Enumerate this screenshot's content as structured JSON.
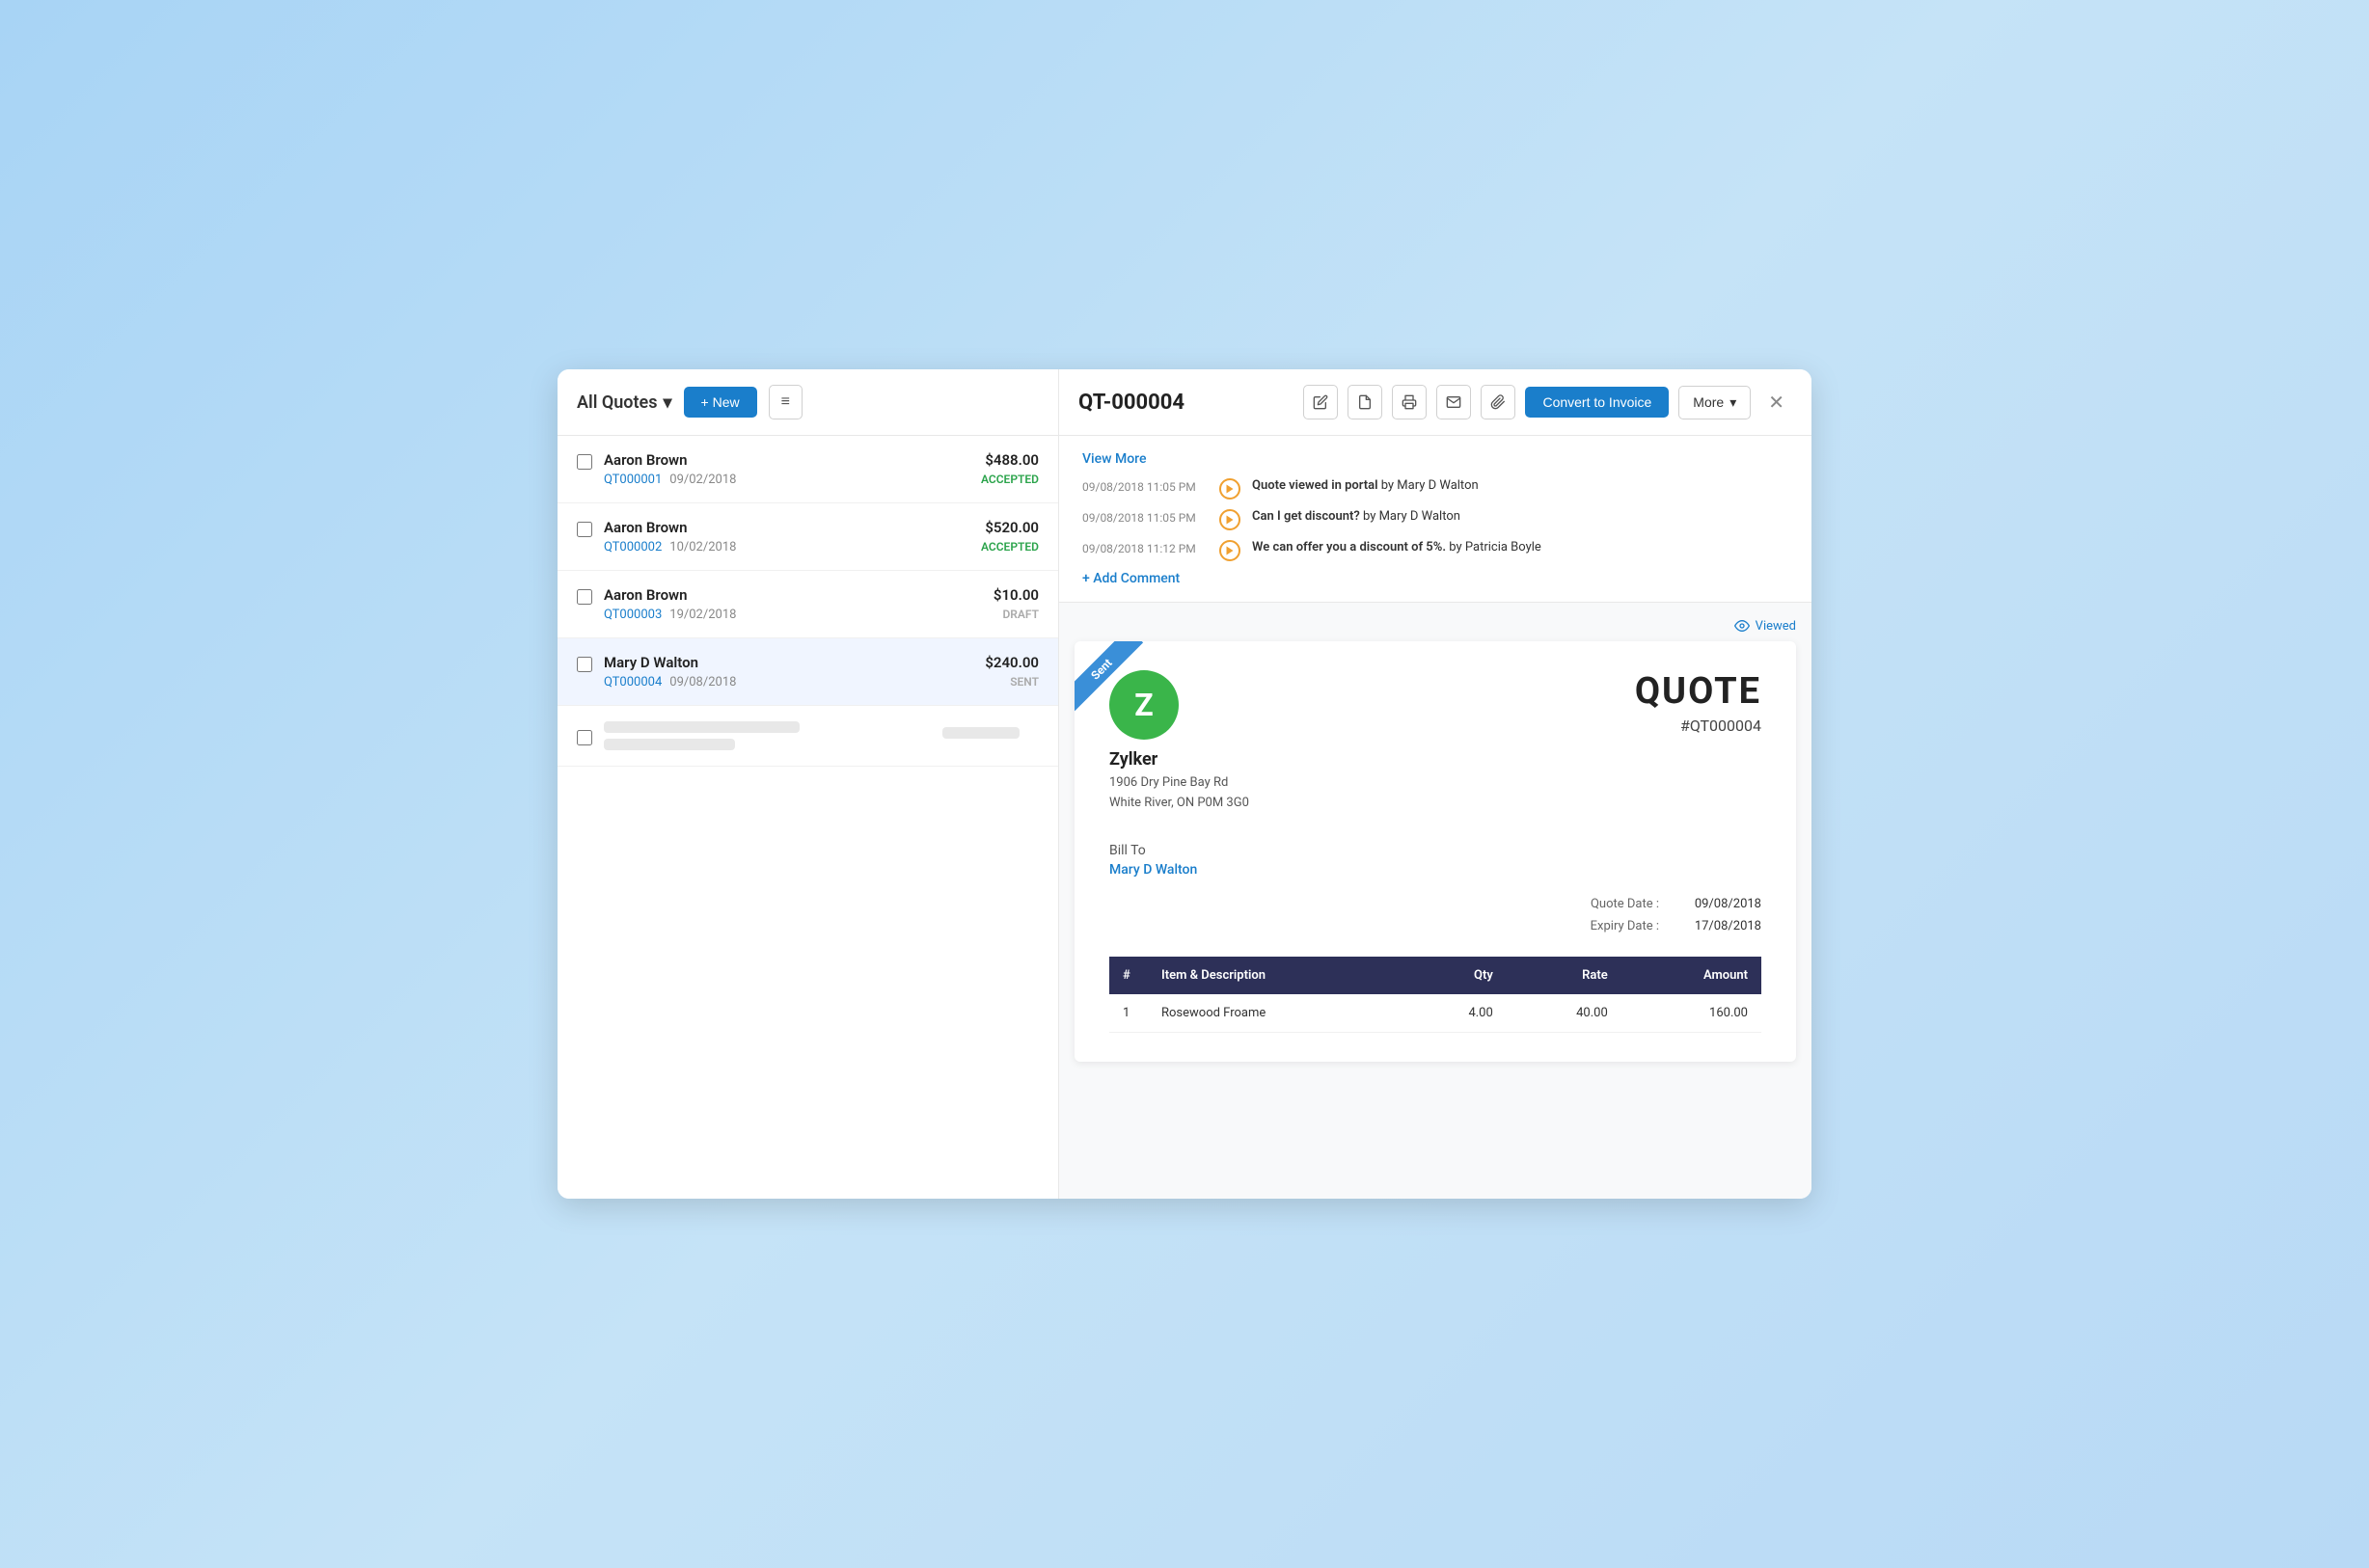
{
  "header": {
    "left": {
      "title": "All Quotes",
      "dropdown_arrow": "▾",
      "new_button": "+ New",
      "menu_icon": "≡"
    },
    "right": {
      "quote_id": "QT-000004",
      "convert_button": "Convert to Invoice",
      "more_button": "More",
      "more_arrow": "▾",
      "close_icon": "✕"
    }
  },
  "list": {
    "items": [
      {
        "name": "Aaron Brown",
        "id": "QT000001",
        "date": "09/02/2018",
        "amount": "$488.00",
        "status": "ACCEPTED",
        "status_class": "status-accepted",
        "active": false
      },
      {
        "name": "Aaron Brown",
        "id": "QT000002",
        "date": "10/02/2018",
        "amount": "$520.00",
        "status": "ACCEPTED",
        "status_class": "status-accepted",
        "active": false
      },
      {
        "name": "Aaron Brown",
        "id": "QT000003",
        "date": "19/02/2018",
        "amount": "$10.00",
        "status": "DRAFT",
        "status_class": "status-draft",
        "active": false
      },
      {
        "name": "Mary D Walton",
        "id": "QT000004",
        "date": "09/08/2018",
        "amount": "$240.00",
        "status": "SENT",
        "status_class": "status-sent",
        "active": true
      }
    ]
  },
  "comments": {
    "view_more": "View More",
    "add_comment": "+ Add Comment",
    "items": [
      {
        "time": "09/08/2018  11:05 PM",
        "text": "Quote viewed in portal",
        "author": "by Mary D Walton"
      },
      {
        "time": "09/08/2018  11:05 PM",
        "text": "Can I get discount?",
        "author": "by Mary D Walton"
      },
      {
        "time": "09/08/2018  11:12 PM",
        "text": "We can offer you a discount of 5%.",
        "author": "by Patricia Boyle"
      }
    ]
  },
  "quote_preview": {
    "ribbon": "Sent",
    "viewed_text": "Viewed",
    "company_initial": "Z",
    "company_name": "Zylker",
    "company_address_line1": "1906 Dry Pine Bay Rd",
    "company_address_line2": "White River, ON P0M 3G0",
    "quote_label": "QUOTE",
    "quote_number": "#QT000004",
    "bill_to_label": "Bill To",
    "bill_to_name": "Mary D Walton",
    "quote_date_label": "Quote Date :",
    "quote_date_value": "09/08/2018",
    "expiry_date_label": "Expiry Date :",
    "expiry_date_value": "17/08/2018",
    "table": {
      "headers": [
        "#",
        "Item & Description",
        "Qty",
        "Rate",
        "Amount"
      ],
      "rows": [
        {
          "num": "1",
          "item": "Rosewood Froame",
          "qty": "4.00",
          "rate": "40.00",
          "amount": "160.00"
        }
      ]
    }
  }
}
